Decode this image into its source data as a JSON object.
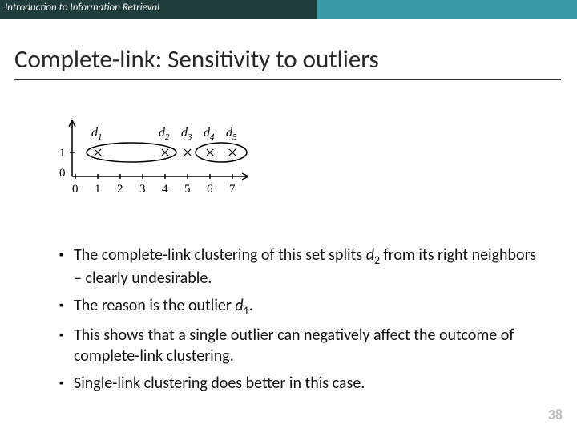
{
  "header": {
    "course": "Introduction to Information Retrieval"
  },
  "title": "Complete-link: Sensitivity to outliers",
  "diagram": {
    "y_ticks": [
      "1",
      "0"
    ],
    "x_ticks": [
      "0",
      "1",
      "2",
      "3",
      "4",
      "5",
      "6",
      "7"
    ],
    "points": [
      {
        "label": "d",
        "sub": "1",
        "x": 1
      },
      {
        "label": "d",
        "sub": "2",
        "x": 4
      },
      {
        "label": "d",
        "sub": "3",
        "x": 5
      },
      {
        "label": "d",
        "sub": "4",
        "x": 6
      },
      {
        "label": "d",
        "sub": "5",
        "x": 7
      }
    ]
  },
  "bullets": [
    {
      "pre": "The complete-link clustering of this set splits ",
      "var": "d",
      "sub": "2",
      "post": " from its right neighbors – clearly undesirable."
    },
    {
      "pre": "The reason is the outlier ",
      "var": "d",
      "sub": "1",
      "post": "."
    },
    {
      "pre": "This shows that a single outlier can negatively affect the outcome of complete-link clustering.",
      "var": "",
      "sub": "",
      "post": ""
    },
    {
      "pre": "Single-link clustering does better in this case.",
      "var": "",
      "sub": "",
      "post": ""
    }
  ],
  "pagenum": "38"
}
